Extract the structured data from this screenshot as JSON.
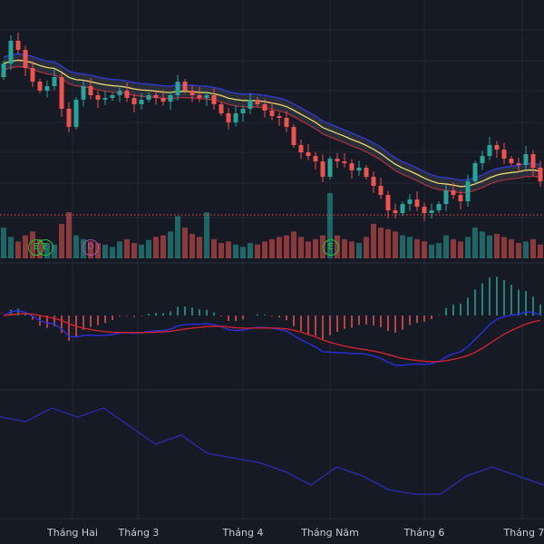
{
  "chart_data": {
    "type": "candlestick",
    "title": "",
    "colors": {
      "up": "#26a69a",
      "down": "#ef5350",
      "ema": "#e8d96a",
      "band_upper": "#2f37c8",
      "band_lower": "#b03040",
      "band_fill": "#3a3f4d",
      "macd": "#2a2ee0",
      "signal": "#d0232f",
      "osc": "#2a2aa8",
      "price_line": "#ef5350",
      "background": "#161a25",
      "grid": "#222633"
    },
    "x_tick_labels": [
      "Tháng Hai",
      "Tháng 3",
      "Tháng 4",
      "Tháng Năm",
      "Tháng 6",
      "Tháng 7"
    ],
    "x_tick_index": [
      9.5,
      18.5,
      33,
      45,
      58,
      71.5
    ],
    "closes": [
      24.0,
      26.5,
      25.5,
      23.5,
      22.0,
      21.0,
      21.5,
      22.5,
      19.0,
      17.0,
      20.0,
      21.5,
      20.5,
      20.0,
      20.2,
      20.5,
      21.0,
      20.2,
      19.5,
      20.0,
      20.5,
      20.2,
      19.8,
      20.5,
      22.0,
      21.0,
      20.5,
      20.2,
      20.5,
      19.5,
      18.5,
      17.5,
      18.5,
      19.0,
      20.0,
      19.5,
      18.8,
      18.2,
      18.0,
      17.0,
      15.0,
      14.2,
      13.8,
      13.2,
      11.5,
      13.5,
      13.2,
      13.0,
      12.2,
      12.5,
      11.5,
      10.5,
      9.5,
      7.8,
      7.5,
      8.5,
      9.0,
      8.2,
      7.5,
      7.8,
      8.5,
      10.0,
      9.5,
      8.8,
      11.0,
      13.0,
      13.8,
      15.0,
      14.5,
      13.5,
      13.0,
      12.8,
      14.0,
      12.5,
      11.0
    ],
    "first_open": 22.5,
    "price_range": [
      5,
      31
    ],
    "current_price_line": 7.3,
    "volume": [
      40,
      28,
      22,
      30,
      35,
      25,
      20,
      18,
      45,
      60,
      30,
      25,
      22,
      20,
      18,
      15,
      22,
      25,
      20,
      18,
      24,
      28,
      30,
      35,
      55,
      40,
      32,
      28,
      60,
      25,
      20,
      22,
      18,
      15,
      20,
      18,
      22,
      25,
      28,
      30,
      35,
      28,
      22,
      25,
      30,
      85,
      30,
      25,
      22,
      20,
      28,
      45,
      40,
      38,
      35,
      30,
      28,
      25,
      22,
      18,
      20,
      30,
      25,
      22,
      28,
      40,
      35,
      30,
      32,
      28,
      25,
      20,
      22,
      25,
      18
    ],
    "events": [
      {
        "label": "E",
        "index": 4.5,
        "type": "earnings"
      },
      {
        "label": "E",
        "index": 5.7,
        "type": "earnings"
      },
      {
        "label": "D",
        "index": 12,
        "type": "dividend"
      },
      {
        "label": "E",
        "index": 45.1,
        "type": "earnings"
      }
    ],
    "macd": {
      "fast": 12,
      "slow": 26,
      "signal": 9
    },
    "oscillator": {
      "name": "",
      "range": [
        0,
        100
      ],
      "values": [
        81.5,
        77.8,
        88.9,
        81.5,
        88.9,
        74.1,
        59.3,
        66.7,
        51.9,
        48.1,
        44.4,
        37.0,
        25.9,
        40.7,
        33.3,
        22.2,
        18.5,
        18.5,
        33.3,
        40.7,
        33.3,
        25.9
      ]
    }
  }
}
